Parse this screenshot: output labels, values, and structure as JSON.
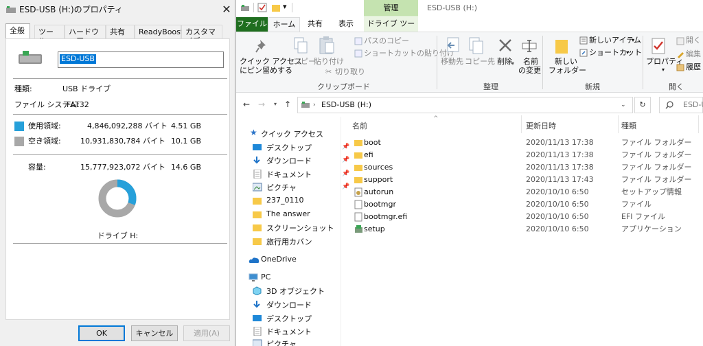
{
  "dialog": {
    "title": "ESD-USB (H:)のプロパティ",
    "tabs": [
      "全般",
      "ツール",
      "ハードウェア",
      "共有",
      "ReadyBoost",
      "カスタマイズ"
    ],
    "volume_name": "ESD-USB",
    "type_label": "種類:",
    "type_value": "USB ドライブ",
    "fs_label": "ファイル システム:",
    "fs_value": "FAT32",
    "used_label": "使用領域:",
    "used_bytes": "4,846,092,288 バイト",
    "used_gb": "4.51 GB",
    "free_label": "空き領域:",
    "free_bytes": "10,931,830,784 バイト",
    "free_gb": "10.1 GB",
    "cap_label": "容量:",
    "cap_bytes": "15,777,923,072 バイト",
    "cap_gb": "14.6 GB",
    "drive_label": "ドライブ H:",
    "ok": "OK",
    "cancel": "キャンセル",
    "apply": "適用(A)",
    "used_fraction": 0.307,
    "used_color": "#26a0da",
    "free_color": "#a8a8a8"
  },
  "explorer": {
    "qat_title": "ESD-USB (H:)",
    "context_tab": "管理",
    "tabs": {
      "file": "ファイル",
      "home": "ホーム",
      "share": "共有",
      "view": "表示",
      "drive_tools": "ドライブ ツール"
    },
    "ribbon": {
      "pin_l1": "クイック アクセス",
      "pin_l2": "にピン留めする",
      "copy": "コピー",
      "paste": "貼り付け",
      "copy_path": "パスのコピー",
      "paste_shortcut": "ショートカットの貼り付け",
      "cut": "切り取り",
      "clipboard": "クリップボード",
      "move_to": "移動先",
      "copy_to": "コピー先",
      "delete": "削除",
      "rename_l1": "名前",
      "rename_l2": "の変更",
      "organize": "整理",
      "new_folder_l1": "新しい",
      "new_folder_l2": "フォルダー",
      "new_item": "新しいアイテム",
      "shortcut": "ショートカット",
      "new_group": "新規",
      "properties": "プロパティ",
      "open": "開く",
      "edit": "編集",
      "history": "履歴",
      "open_group": "開く"
    },
    "address": "ESD-USB (H:)",
    "search_placeholder": "ESD-U",
    "nav": {
      "quick_access": "クイック アクセス",
      "items": [
        "デスクトップ",
        "ダウンロード",
        "ドキュメント",
        "ピクチャ",
        "237_0110",
        "The answer",
        "スクリーンショット",
        "旅行用カバン"
      ],
      "onedrive": "OneDrive",
      "pc": "PC",
      "pc_items": [
        "3D オブジェクト",
        "ダウンロード",
        "デスクトップ",
        "ドキュメント",
        "ピクチャ"
      ]
    },
    "columns": {
      "name": "名前",
      "date": "更新日時",
      "type": "種類"
    },
    "files": [
      {
        "name": "boot",
        "date": "2020/11/13 17:38",
        "type": "ファイル フォルダー",
        "icon": "folder-icon"
      },
      {
        "name": "efi",
        "date": "2020/11/13 17:38",
        "type": "ファイル フォルダー",
        "icon": "folder-icon"
      },
      {
        "name": "sources",
        "date": "2020/11/13 17:38",
        "type": "ファイル フォルダー",
        "icon": "folder-icon"
      },
      {
        "name": "support",
        "date": "2020/11/13 17:43",
        "type": "ファイル フォルダー",
        "icon": "folder-icon"
      },
      {
        "name": "autorun",
        "date": "2020/10/10 6:50",
        "type": "セットアップ情報",
        "icon": "setup-info-icon"
      },
      {
        "name": "bootmgr",
        "date": "2020/10/10 6:50",
        "type": "ファイル",
        "icon": "file-icon"
      },
      {
        "name": "bootmgr.efi",
        "date": "2020/10/10 6:50",
        "type": "EFI ファイル",
        "icon": "file-icon"
      },
      {
        "name": "setup",
        "date": "2020/10/10 6:50",
        "type": "アプリケーション",
        "icon": "setup-app-icon"
      }
    ]
  }
}
